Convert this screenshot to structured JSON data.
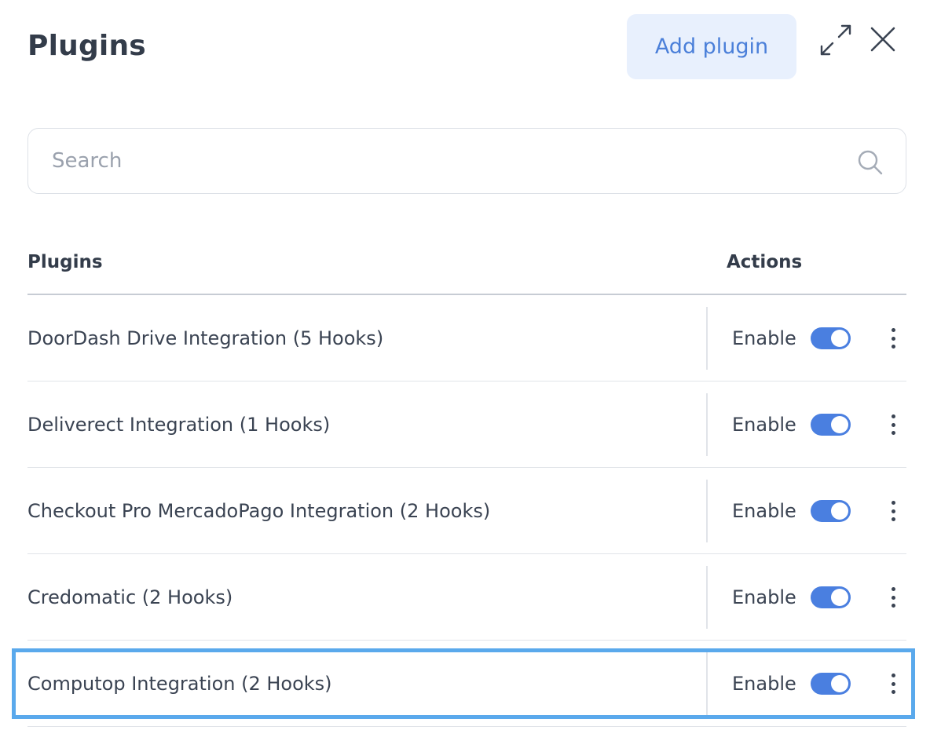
{
  "header": {
    "title": "Plugins",
    "add_plugin_label": "Add plugin",
    "expand_icon": "expand-icon",
    "close_icon": "close-icon"
  },
  "search": {
    "placeholder": "Search",
    "value": "",
    "icon": "search-icon"
  },
  "table": {
    "columns": [
      "Plugins",
      "Actions"
    ],
    "rows": [
      {
        "name": "DoorDash Drive Integration (5 Hooks)",
        "toggle_label": "Enable",
        "enabled": true
      },
      {
        "name": "Deliverect Integration (1 Hooks)",
        "toggle_label": "Enable",
        "enabled": true
      },
      {
        "name": "Checkout Pro MercadoPago Integration (2 Hooks)",
        "toggle_label": "Enable",
        "enabled": true
      },
      {
        "name": "Credomatic (2 Hooks)",
        "toggle_label": "Enable",
        "enabled": true
      },
      {
        "name": "Computop Integration (2 Hooks)",
        "toggle_label": "Enable",
        "enabled": true
      }
    ]
  },
  "colors": {
    "accent": "#4a7fe0",
    "button_bg": "#e8f0fd",
    "highlight": "#5aa9ec"
  }
}
